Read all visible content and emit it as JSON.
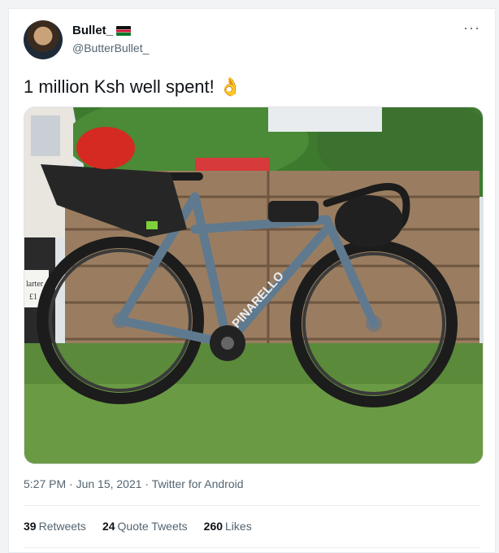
{
  "tweet": {
    "display_name": "Bullet_",
    "handle": "@ButterBullet_",
    "more_label": "···",
    "text": "1 million Ksh well spent!",
    "emoji": "👌",
    "timestamp": "5:27 PM · Jun 15, 2021 · Twitter for Android"
  },
  "photo": {
    "frame_brand": "PINARELLO",
    "bin_text_1": "larter",
    "bin_text_2": "£1"
  },
  "stats": {
    "retweets_count": "39",
    "retweets_label": "Retweets",
    "quotes_count": "24",
    "quotes_label": "Quote Tweets",
    "likes_count": "260",
    "likes_label": "Likes"
  }
}
